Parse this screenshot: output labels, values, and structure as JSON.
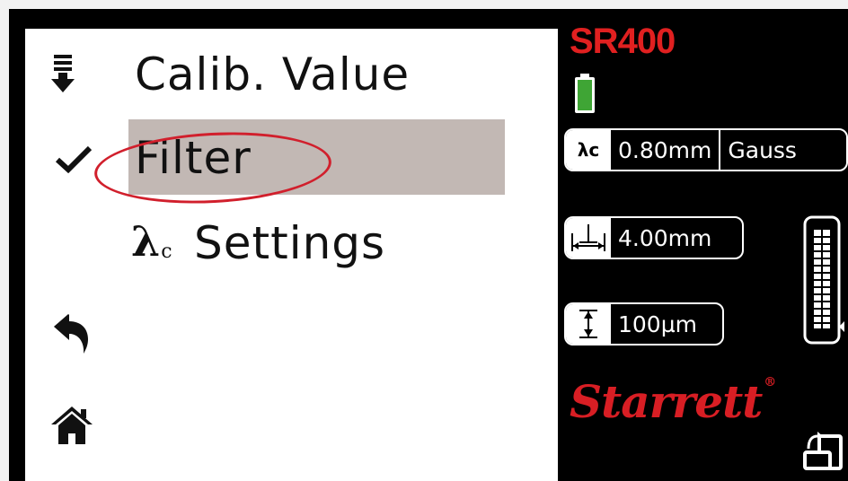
{
  "menu": {
    "items": [
      {
        "icon": "download-arrow-icon",
        "label": "Calib. Value"
      },
      {
        "icon": "checkmark-icon",
        "label": "Filter",
        "selected": true
      },
      {
        "icon": "lambda-c-icon",
        "symbol": "λ",
        "subscript": "c",
        "label": "Settings"
      }
    ],
    "back_icon": "back-arrow-icon",
    "home_icon": "home-icon"
  },
  "status": {
    "model": "SR400",
    "battery_icon": "battery-icon",
    "filter": {
      "key": "λc",
      "cutoff": "0.80mm",
      "type": "Gauss"
    },
    "evaluation_length": "4.00mm",
    "range": "100µm",
    "brand": "Starrett",
    "brand_mark": "®"
  },
  "colors": {
    "accent_red": "#e02020",
    "selection_bg": "#c2b8b4",
    "annotation_red": "#d11f2c",
    "battery_green": "#3fa535"
  }
}
